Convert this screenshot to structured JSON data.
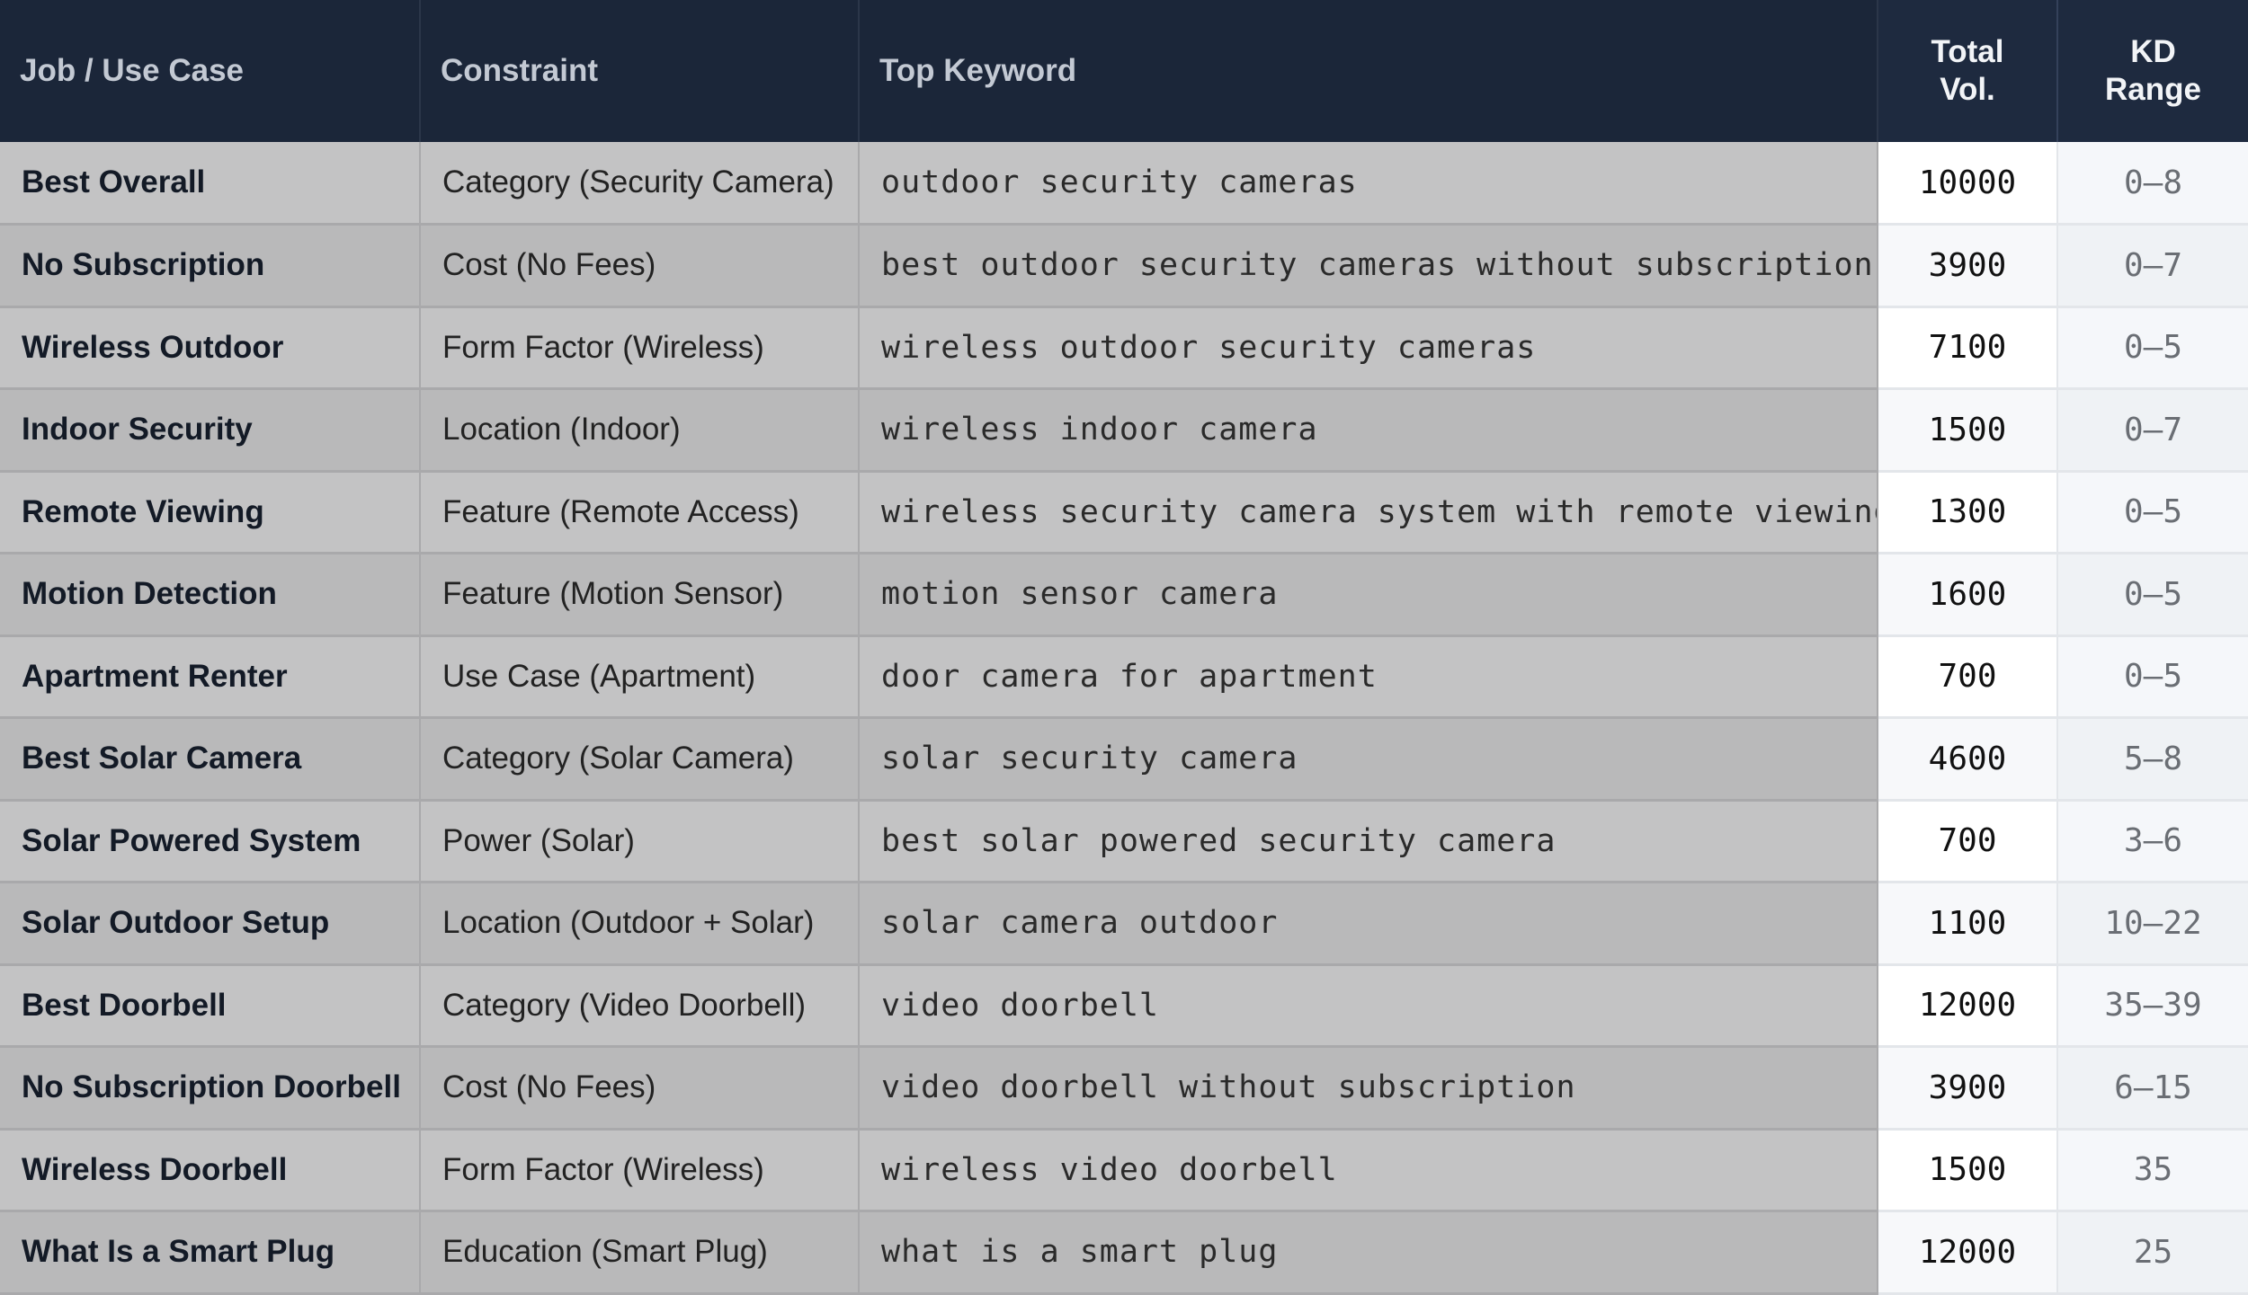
{
  "table": {
    "headers": {
      "job": "Job / Use Case",
      "constraint": "Constraint",
      "top_keyword": "Top Keyword",
      "total_vol_line1": "Total",
      "total_vol_line2": "Vol.",
      "kd_range_line1": "KD",
      "kd_range_line2": "Range"
    },
    "rows": [
      {
        "job": "Best Overall",
        "constraint": "Category (Security Camera)",
        "keyword": "outdoor security cameras",
        "volume": "10000",
        "kd": "0–8"
      },
      {
        "job": "No Subscription",
        "constraint": "Cost (No Fees)",
        "keyword": "best outdoor security cameras without subscription",
        "volume": "3900",
        "kd": "0–7"
      },
      {
        "job": "Wireless Outdoor",
        "constraint": "Form Factor (Wireless)",
        "keyword": "wireless outdoor security cameras",
        "volume": "7100",
        "kd": "0–5"
      },
      {
        "job": "Indoor Security",
        "constraint": "Location (Indoor)",
        "keyword": "wireless indoor camera",
        "volume": "1500",
        "kd": "0–7"
      },
      {
        "job": "Remote Viewing",
        "constraint": "Feature (Remote Access)",
        "keyword": "wireless security camera system with remote viewing",
        "volume": "1300",
        "kd": "0–5"
      },
      {
        "job": "Motion Detection",
        "constraint": "Feature (Motion Sensor)",
        "keyword": "motion sensor camera",
        "volume": "1600",
        "kd": "0–5"
      },
      {
        "job": "Apartment Renter",
        "constraint": "Use Case (Apartment)",
        "keyword": "door camera for apartment",
        "volume": "700",
        "kd": "0–5"
      },
      {
        "job": "Best Solar Camera",
        "constraint": "Category (Solar Camera)",
        "keyword": "solar security camera",
        "volume": "4600",
        "kd": "5–8"
      },
      {
        "job": "Solar Powered System",
        "constraint": "Power (Solar)",
        "keyword": "best solar powered security camera",
        "volume": "700",
        "kd": "3–6"
      },
      {
        "job": "Solar Outdoor Setup",
        "constraint": "Location (Outdoor + Solar)",
        "keyword": "solar camera outdoor",
        "volume": "1100",
        "kd": "10–22"
      },
      {
        "job": "Best Doorbell",
        "constraint": "Category (Video Doorbell)",
        "keyword": "video doorbell",
        "volume": "12000",
        "kd": "35–39"
      },
      {
        "job": "No Subscription Doorbell",
        "constraint": "Cost (No Fees)",
        "keyword": "video doorbell without subscription",
        "volume": "3900",
        "kd": "6–15"
      },
      {
        "job": "Wireless Doorbell",
        "constraint": "Form Factor (Wireless)",
        "keyword": "wireless video doorbell",
        "volume": "1500",
        "kd": "35"
      },
      {
        "job": "What Is a Smart Plug",
        "constraint": "Education (Smart Plug)",
        "keyword": "what is a smart plug",
        "volume": "12000",
        "kd": "25"
      }
    ]
  }
}
